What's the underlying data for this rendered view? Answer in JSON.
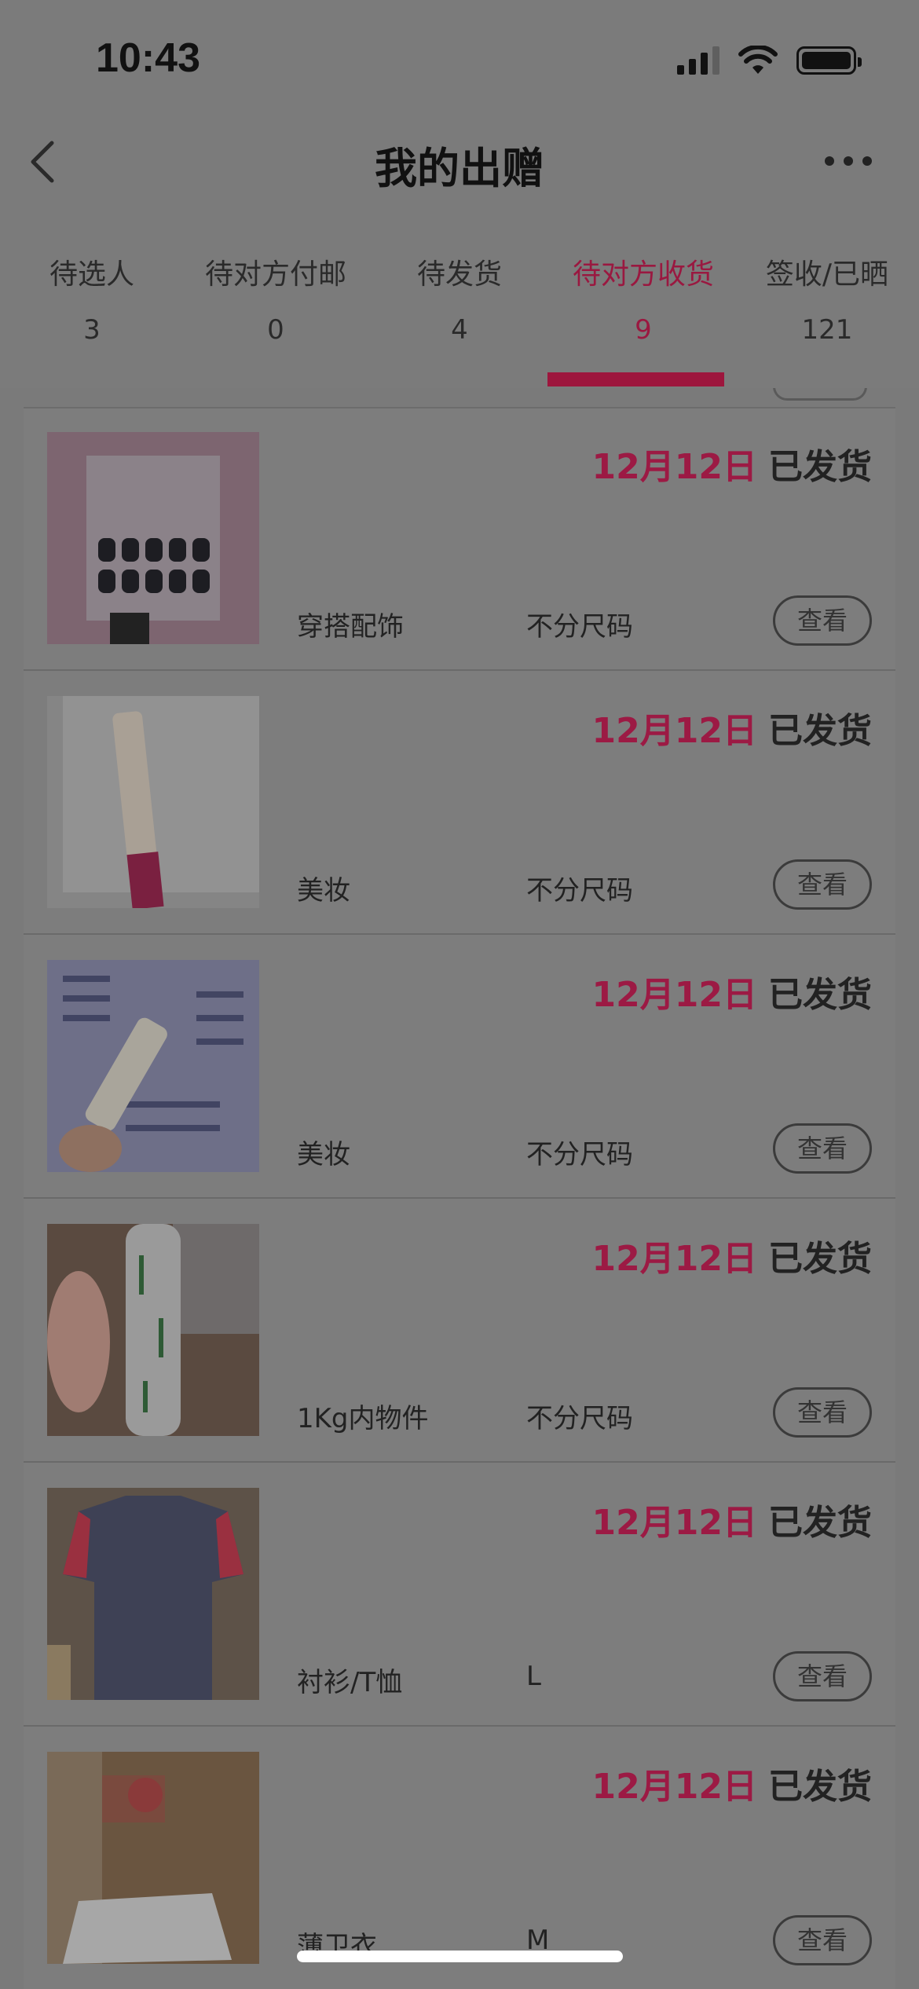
{
  "status_bar": {
    "time": "10:43"
  },
  "header": {
    "title": "我的出赠"
  },
  "tabs": [
    {
      "label": "待选人",
      "count": "3"
    },
    {
      "label": "待对方付邮",
      "count": "0"
    },
    {
      "label": "待发货",
      "count": "4"
    },
    {
      "label": "待对方收货",
      "count": "9",
      "active": true
    },
    {
      "label": "签收/已晒",
      "count": "121"
    }
  ],
  "items": [
    {
      "date": "12月12日",
      "status": "已发货",
      "category": "穿搭配饰",
      "size": "不分尺码",
      "action": "查看"
    },
    {
      "date": "12月12日",
      "status": "已发货",
      "category": "美妆",
      "size": "不分尺码",
      "action": "查看"
    },
    {
      "date": "12月12日",
      "status": "已发货",
      "category": "美妆",
      "size": "不分尺码",
      "action": "查看"
    },
    {
      "date": "12月12日",
      "status": "已发货",
      "category": "1Kg内物件",
      "size": "不分尺码",
      "action": "查看"
    },
    {
      "date": "12月12日",
      "status": "已发货",
      "category": "衬衫/T恤",
      "size": "L",
      "action": "查看"
    },
    {
      "date": "12月12日",
      "status": "已发货",
      "category": "薄卫衣",
      "size": "M",
      "action": "查看"
    }
  ],
  "colors": {
    "accent": "#9d163d",
    "overlay_bg": "#7a7a7a"
  }
}
